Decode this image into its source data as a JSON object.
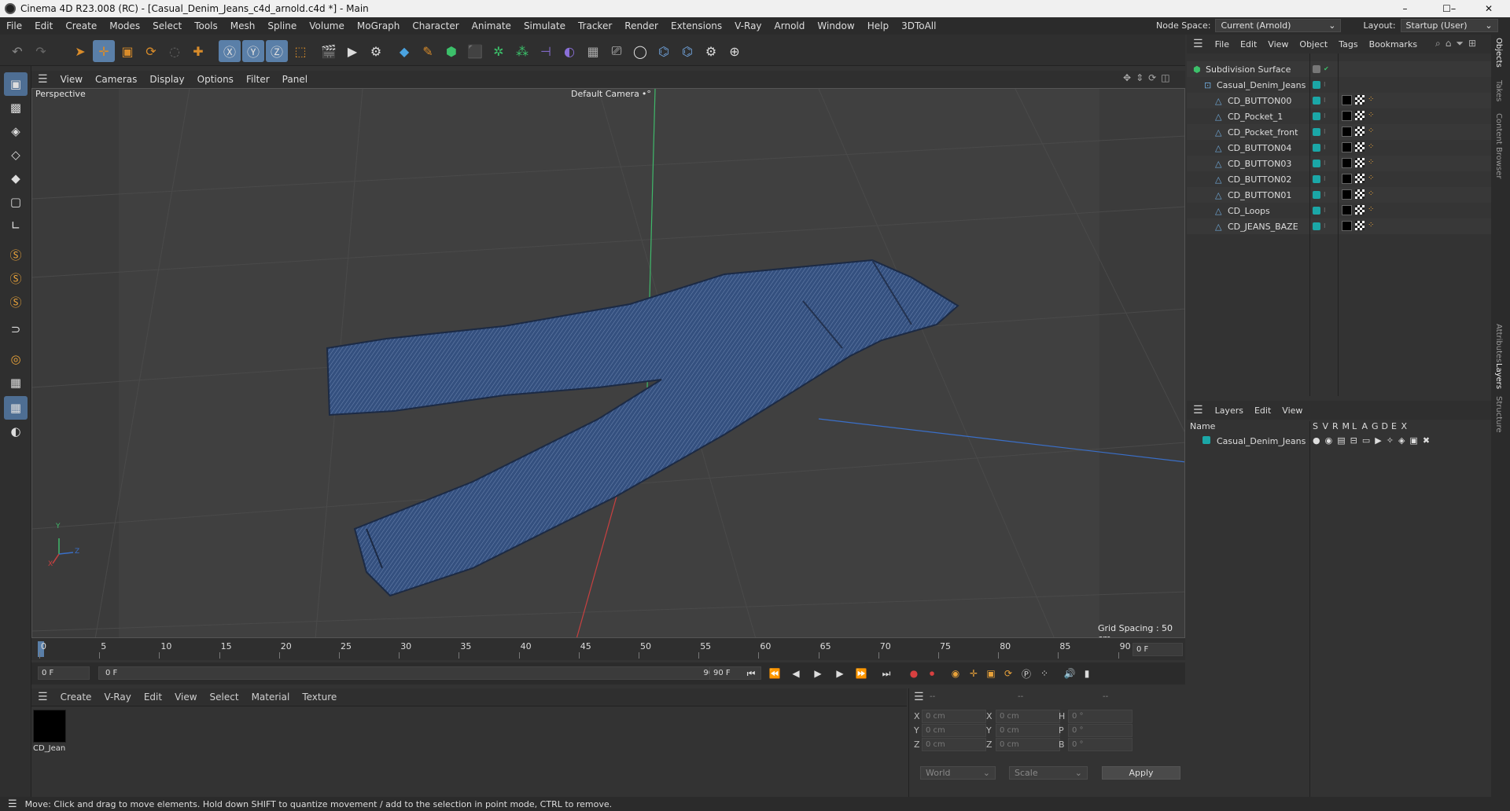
{
  "app": {
    "title": "Cinema 4D R23.008 (RC) - [Casual_Denim_Jeans_c4d_arnold.c4d *] - Main",
    "window_controls": [
      "–",
      "☐",
      "✕"
    ]
  },
  "menubar": {
    "items": [
      "File",
      "Edit",
      "Create",
      "Modes",
      "Select",
      "Tools",
      "Mesh",
      "Spline",
      "Volume",
      "MoGraph",
      "Character",
      "Animate",
      "Simulate",
      "Tracker",
      "Render",
      "Extensions",
      "V-Ray",
      "Arnold",
      "Window",
      "Help",
      "3DToAll"
    ],
    "node_space_label": "Node Space:",
    "node_space_value": "Current (Arnold)",
    "layout_label": "Layout:",
    "layout_value": "Startup (User)"
  },
  "toolbar": {
    "icons": [
      "undo-icon",
      "redo-icon",
      "live-select-icon",
      "move-icon",
      "scale-icon",
      "rotate-icon",
      "recent-tool-icon",
      "add-icon",
      "x-axis-icon",
      "y-axis-icon",
      "z-axis-icon",
      "coordinate-system-icon",
      "render-region-icon",
      "render-view-icon",
      "render-settings-icon",
      "cube-icon",
      "pen-icon",
      "subdivision-icon",
      "extrude-icon",
      "cloner-icon",
      "array-icon",
      "symmetry-icon",
      "deformer-icon",
      "floor-icon",
      "camera-icon",
      "light-icon",
      "python-icon",
      "python2-icon",
      "gear-icon",
      "globe-icon"
    ],
    "axis_labels": [
      "X",
      "Y",
      "Z"
    ]
  },
  "left_tools": {
    "icons": [
      "model-mode-icon",
      "texture-mode-icon",
      "points-mode-icon",
      "edges-mode-icon",
      "polygons-mode-icon",
      "object-axis-icon",
      "uv-icon",
      "snap-icon",
      "solo-icon",
      "solo-hierarchy-icon",
      "solo-off-icon",
      "magnet-icon",
      "workplane-icon",
      "grid-icon",
      "quantize-icon"
    ]
  },
  "viewport": {
    "menu": [
      "View",
      "Cameras",
      "Display",
      "Options",
      "Filter",
      "Panel"
    ],
    "label": "Perspective",
    "camera": "Default Camera",
    "camera_glyph": "•°",
    "grid_spacing": "Grid Spacing : 50 cm",
    "axis_x": "X",
    "axis_y": "Y",
    "axis_z": "Z"
  },
  "timeline": {
    "ticks": [
      "0",
      "5",
      "10",
      "15",
      "20",
      "25",
      "30",
      "35",
      "40",
      "45",
      "50",
      "55",
      "60",
      "65",
      "70",
      "75",
      "80",
      "85",
      "90"
    ],
    "current_frame_field": "0 F"
  },
  "transport": {
    "start_field": "0 F",
    "range_start": "0 F",
    "range_end": "90 F",
    "end_field": "90 F"
  },
  "materials": {
    "menu": [
      "Create",
      "V-Ray",
      "Edit",
      "View",
      "Select",
      "Material",
      "Texture"
    ],
    "items": [
      {
        "name": "CD_Jean",
        "color": "#000000"
      }
    ]
  },
  "coordinates": {
    "headers": [
      "--",
      "--",
      "--"
    ],
    "rows": [
      {
        "l1": "X",
        "v1": "0 cm",
        "l2": "X",
        "v2": "0 cm",
        "l3": "H",
        "v3": "0 °"
      },
      {
        "l1": "Y",
        "v1": "0 cm",
        "l2": "Y",
        "v2": "0 cm",
        "l3": "P",
        "v3": "0 °"
      },
      {
        "l1": "Z",
        "v1": "0 cm",
        "l2": "Z",
        "v2": "0 cm",
        "l3": "B",
        "v3": "0 °"
      }
    ],
    "space": "World",
    "mode": "Scale",
    "apply": "Apply"
  },
  "objects": {
    "menu": [
      "File",
      "Edit",
      "View",
      "Object",
      "Tags",
      "Bookmarks"
    ],
    "rows": [
      {
        "name": "Subdivision Surface",
        "level": 0,
        "type": "subdiv"
      },
      {
        "name": "Casual_Denim_Jeans",
        "level": 1,
        "type": "null"
      },
      {
        "name": "CD_BUTTON00",
        "level": 2,
        "type": "mesh"
      },
      {
        "name": "CD_Pocket_1",
        "level": 2,
        "type": "mesh"
      },
      {
        "name": "CD_Pocket_front",
        "level": 2,
        "type": "mesh"
      },
      {
        "name": "CD_BUTTON04",
        "level": 2,
        "type": "mesh"
      },
      {
        "name": "CD_BUTTON03",
        "level": 2,
        "type": "mesh"
      },
      {
        "name": "CD_BUTTON02",
        "level": 2,
        "type": "mesh"
      },
      {
        "name": "CD_BUTTON01",
        "level": 2,
        "type": "mesh"
      },
      {
        "name": "CD_Loops",
        "level": 2,
        "type": "mesh"
      },
      {
        "name": "CD_JEANS_BAZE",
        "level": 2,
        "type": "mesh"
      }
    ]
  },
  "layers": {
    "menu": [
      "Layers",
      "Edit",
      "View"
    ],
    "columns": [
      "Name",
      "S",
      "V",
      "R",
      "M",
      "L",
      "A",
      "G",
      "D",
      "E",
      "X"
    ],
    "rows": [
      {
        "name": "Casual_Denim_Jeans",
        "color": "#1ba7a7"
      }
    ]
  },
  "right_tabs": [
    "Objects",
    "Takes",
    "Content Browser",
    "Attributes",
    "Layers",
    "Structure"
  ],
  "status": {
    "text": "Move: Click and drag to move elements. Hold down SHIFT to quantize movement / add to the selection in point mode, CTRL to remove."
  },
  "colors": {
    "accent": "#5a7fa8",
    "layer_teal": "#1ba7a7",
    "denim": "#2f4a78"
  }
}
